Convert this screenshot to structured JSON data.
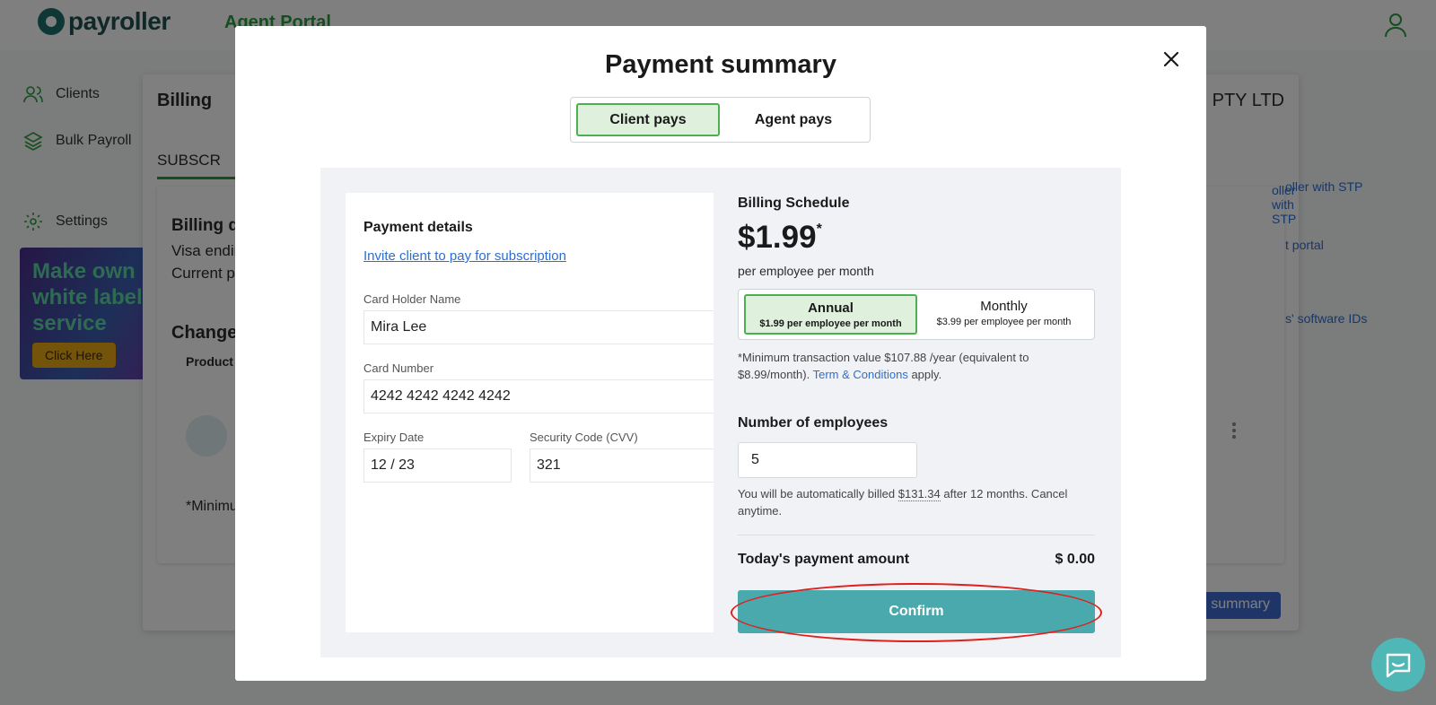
{
  "app": {
    "logo_text": "payroller",
    "portal_title": "Agent Portal"
  },
  "sidebar": {
    "items": [
      {
        "label": "Clients",
        "icon": "users-icon"
      },
      {
        "label": "Bulk Payroll",
        "icon": "layers-icon"
      },
      {
        "label": "Settings",
        "icon": "gear-icon"
      }
    ],
    "promo": {
      "text": "Make own white label service",
      "button": "Click Here"
    }
  },
  "background": {
    "billing_title": "Billing",
    "company_suffix": "PTY LTD",
    "tab_label": "SUBSCR",
    "card_heading": "Billing d",
    "visa_line": "Visa endin",
    "current_line": "Current p",
    "change_heading": "Change",
    "product_col": "Product",
    "minimum_text": "*Minimu",
    "link1": "oller with STP",
    "link2": "t portal",
    "link3": "s' software IDs",
    "summary_button": "summary"
  },
  "modal": {
    "title": "Payment summary",
    "payer_options": [
      "Client pays",
      "Agent pays"
    ],
    "payer_selected": "Client pays",
    "payment_details": {
      "heading": "Payment details",
      "invite_link": "Invite client to pay for subscription",
      "card_holder_label": "Card Holder Name",
      "card_holder_value": "Mira Lee",
      "card_number_label": "Card Number",
      "card_number_value": "4242 4242 4242 4242",
      "expiry_label": "Expiry Date",
      "expiry_value": "12 / 23",
      "cvv_label": "Security Code (CVV)",
      "cvv_value": "321"
    },
    "billing": {
      "heading": "Billing Schedule",
      "price": "$1.99",
      "price_mark": "*",
      "per_employee": "per employee per month",
      "plans": [
        {
          "name": "Annual",
          "sub": "$1.99 per employee per month"
        },
        {
          "name": "Monthly",
          "sub": "$3.99 per employee per month"
        }
      ],
      "plan_selected": "Annual",
      "minimum_note": "*Minimum transaction value $107.88 /year (equivalent to $8.99/month).",
      "terms_link": "Term & Conditions",
      "terms_suffix": "apply.",
      "employees_label": "Number of employees",
      "employees_value": "5",
      "auto_bill_prefix": "You will be automatically billed",
      "auto_bill_amount": "$131.34",
      "auto_bill_suffix": "after 12 months. Cancel anytime.",
      "today_label": "Today's payment amount",
      "today_amount": "$ 0.00",
      "confirm_label": "Confirm"
    }
  },
  "colors": {
    "accent_green": "#4caf50",
    "confirm_teal": "#4aa9ad",
    "link_blue": "#2d6fd1",
    "highlight_red": "#e0201c"
  }
}
